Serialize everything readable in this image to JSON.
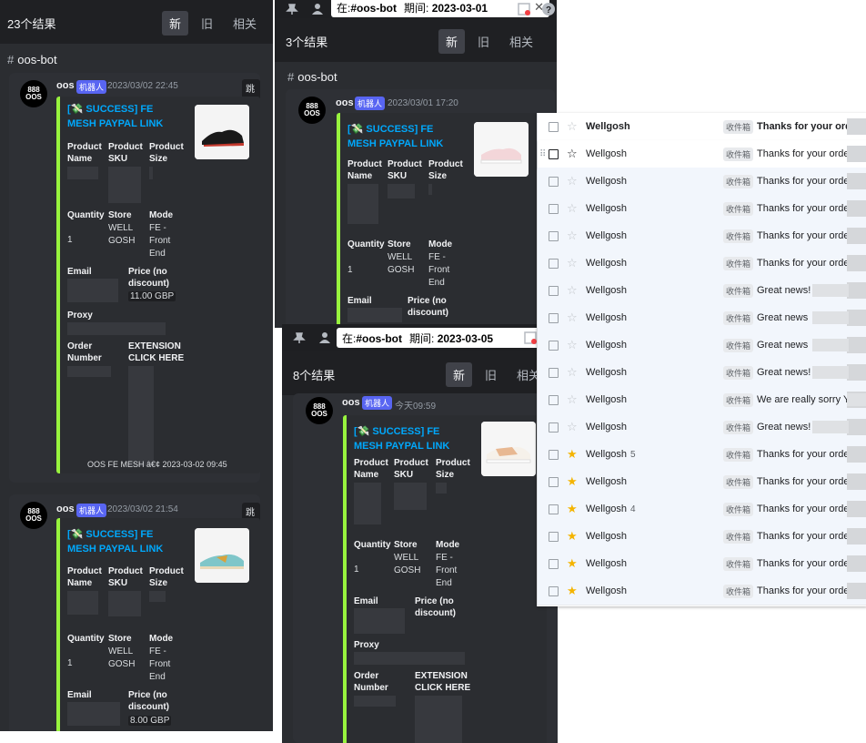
{
  "search_tabs": [
    "新",
    "旧",
    "相关"
  ],
  "panel1": {
    "result_count": "23个结果",
    "channel": "oos-bot",
    "messages": [
      {
        "username": "oos",
        "badge": "机器人",
        "timestamp": "2023/03/02 22:45",
        "jump": "跳到",
        "title": "[💸 SUCCESS] FE MESH PAYPAL LINK",
        "fields": {
          "product_name": "Product Name",
          "product_sku": "Product SKU",
          "product_size": "Product Size",
          "quantity": "Quantity",
          "quantity_value": "1",
          "store": "Store",
          "store_value": "WELLGOSH",
          "mode": "Mode",
          "mode_value": "FE - Front End",
          "email": "Email",
          "price": "Price (no discount)",
          "price_value": "11.00 GBP",
          "proxy": "Proxy",
          "order_number": "Order Number",
          "extension": "EXTENSION CLICK HERE"
        },
        "footer": "OOS FE MESH â€¢ 2023-03-02 09:45"
      },
      {
        "username": "oos",
        "badge": "机器人",
        "timestamp": "2023/03/02 21:54",
        "jump": "跳到",
        "title": "[💸 SUCCESS] FE MESH PAYPAL LINK",
        "fields": {
          "product_name": "Product Name",
          "product_sku": "Product SKU",
          "product_size": "Product Size",
          "quantity": "Quantity",
          "quantity_value": "1",
          "store": "Store",
          "store_value": "WELLGOSH",
          "mode": "Mode",
          "mode_value": "FE - Front End",
          "email": "Email",
          "price": "Price (no discount)",
          "price_value": "8.00 GBP"
        }
      }
    ]
  },
  "panel2": {
    "search_prefix": "在:",
    "search_channel": "#oos-bot",
    "search_date_label": "期间:",
    "search_date": "2023-03-01",
    "result_count": "3个结果",
    "channel": "oos-bot",
    "message": {
      "username": "oos",
      "badge": "机器人",
      "timestamp": "2023/03/01 17:20",
      "title": "[💸 SUCCESS] FE MESH PAYPAL LINK",
      "fields": {
        "product_name": "Product Name",
        "product_sku": "Product SKU",
        "product_size": "Product Size",
        "quantity": "Quantity",
        "quantity_value": "1",
        "store": "Store",
        "store_value": "WELLGOSH",
        "mode": "Mode",
        "mode_value": "FE - Front End",
        "email": "Email",
        "price": "Price (no discount)"
      }
    }
  },
  "panel3": {
    "search_prefix": "在:",
    "search_channel": "#oos-bot",
    "search_date_label": "期间:",
    "search_date": "2023-03-05",
    "result_count": "8个结果",
    "message": {
      "username": "oos",
      "badge": "机器人",
      "timestamp": "今天09:59",
      "title": "[💸 SUCCESS] FE MESH PAYPAL LINK",
      "fields": {
        "product_name": "Product Name",
        "product_sku": "Product SKU",
        "product_size": "Product Size",
        "quantity": "Quantity",
        "quantity_value": "1",
        "store": "Store",
        "store_value": "WELLGOSH",
        "mode": "Mode",
        "mode_value": "FE - Front End",
        "email": "Email",
        "price": "Price (no discount)",
        "proxy": "Proxy",
        "order_number": "Order Number",
        "extension": "EXTENSION CLICK HERE"
      }
    }
  },
  "gmail": {
    "rows": [
      {
        "sender": "Wellgosh",
        "count": "",
        "label": "收件箱",
        "subject": "Thanks for your ord",
        "starred": false,
        "unread": true
      },
      {
        "sender": "Wellgosh",
        "count": "",
        "label": "收件箱",
        "subject": "Thanks for your orde",
        "starred": false,
        "unread": false
      },
      {
        "sender": "Wellgosh",
        "count": "",
        "label": "收件箱",
        "subject": "Thanks for your orde",
        "starred": false,
        "unread": false
      },
      {
        "sender": "Wellgosh",
        "count": "",
        "label": "收件箱",
        "subject": "Thanks for your orde",
        "starred": false,
        "unread": false
      },
      {
        "sender": "Wellgosh",
        "count": "",
        "label": "收件箱",
        "subject": "Thanks for your orde",
        "starred": false,
        "unread": false
      },
      {
        "sender": "Wellgosh",
        "count": "",
        "label": "收件箱",
        "subject": "Thanks for your orde",
        "starred": false,
        "unread": false
      },
      {
        "sender": "Wellgosh",
        "count": "",
        "label": "收件箱",
        "subject": "Great news!",
        "starred": false,
        "unread": false
      },
      {
        "sender": "Wellgosh",
        "count": "",
        "label": "收件箱",
        "subject": "Great news",
        "starred": false,
        "unread": false
      },
      {
        "sender": "Wellgosh",
        "count": "",
        "label": "收件箱",
        "subject": "Great news",
        "starred": false,
        "unread": false
      },
      {
        "sender": "Wellgosh",
        "count": "",
        "label": "收件箱",
        "subject": "Great news!",
        "starred": false,
        "unread": false
      },
      {
        "sender": "Wellgosh",
        "count": "",
        "label": "收件箱",
        "subject": "We are really sorry Y",
        "starred": false,
        "unread": false
      },
      {
        "sender": "Wellgosh",
        "count": "",
        "label": "收件箱",
        "subject": "Great news!",
        "starred": false,
        "unread": false
      },
      {
        "sender": "Wellgosh",
        "count": "5",
        "label": "收件箱",
        "subject": "Thanks for your orde",
        "starred": true,
        "unread": false
      },
      {
        "sender": "Wellgosh",
        "count": "",
        "label": "收件箱",
        "subject": "Thanks for your orde",
        "starred": true,
        "unread": false
      },
      {
        "sender": "Wellgosh",
        "count": "4",
        "label": "收件箱",
        "subject": "Thanks for your orde",
        "starred": true,
        "unread": false
      },
      {
        "sender": "Wellgosh",
        "count": "",
        "label": "收件箱",
        "subject": "Thanks for your orde",
        "starred": true,
        "unread": false
      },
      {
        "sender": "Wellgosh",
        "count": "",
        "label": "收件箱",
        "subject": "Thanks for your orde",
        "starred": true,
        "unread": false
      },
      {
        "sender": "Wellgosh",
        "count": "",
        "label": "收件箱",
        "subject": "Thanks for your orde",
        "starred": true,
        "unread": false
      }
    ]
  },
  "colors": {
    "discord_bg": "#2b2d31",
    "embed_accent": "#98f33e",
    "link": "#00a8fc",
    "bot_badge": "#5865f2",
    "star": "#f4b400"
  },
  "icons": [
    "pin-icon",
    "members-icon",
    "close-icon",
    "inbox-icon",
    "help-icon",
    "hash-icon",
    "star-icon",
    "checkbox-icon",
    "drag-handle-icon"
  ]
}
